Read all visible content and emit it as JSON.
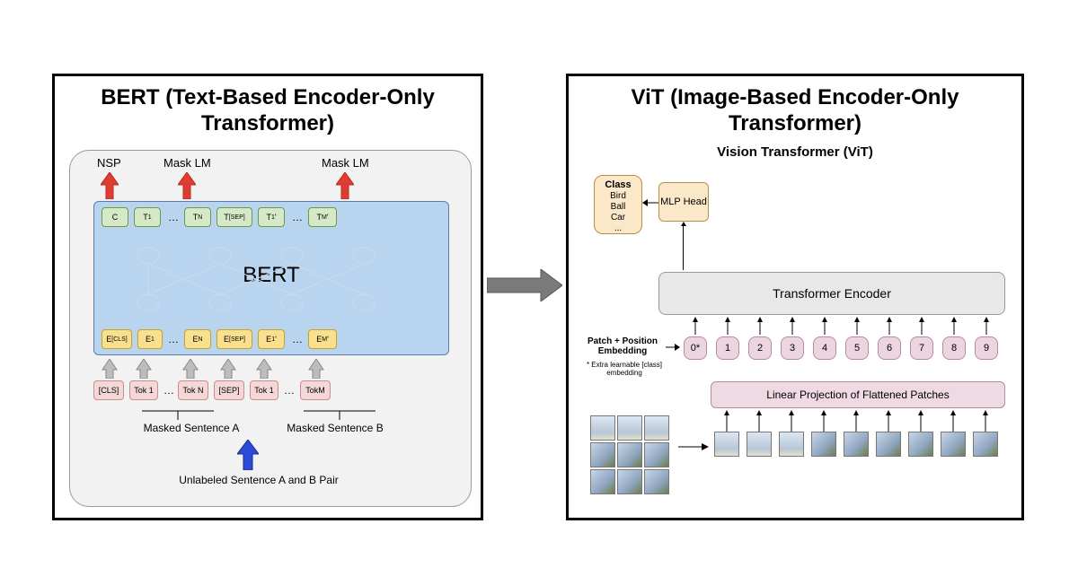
{
  "left": {
    "title": "BERT (Text-Based Encoder-Only Transformer)",
    "top_labels": {
      "nsp": "NSP",
      "mask1": "Mask LM",
      "mask2": "Mask LM"
    },
    "encoder_label": "BERT",
    "output_tokens": [
      "C",
      "T₁",
      "…",
      "T_N",
      "T_[SEP]",
      "T₁'",
      "…",
      "T_M'"
    ],
    "input_embeddings": [
      "E_[CLS]",
      "E₁",
      "…",
      "E_N",
      "E_[SEP]",
      "E₁'",
      "…",
      "E_M'"
    ],
    "input_tokens": [
      "[CLS]",
      "Tok 1",
      "…",
      "Tok N",
      "[SEP]",
      "Tok 1",
      "…",
      "TokM"
    ],
    "caption_a": "Masked Sentence A",
    "caption_b": "Masked Sentence B",
    "caption_pair": "Unlabeled Sentence A and B Pair"
  },
  "right": {
    "title": "ViT (Image-Based Encoder-Only Transformer)",
    "subtitle": "Vision Transformer (ViT)",
    "class_box": {
      "heading": "Class",
      "items": [
        "Bird",
        "Ball",
        "Car",
        "..."
      ]
    },
    "mlp_label": "MLP Head",
    "encoder_label": "Transformer Encoder",
    "patchpos_label": "Patch + Position Embedding",
    "patchpos_note": "* Extra learnable [class] embedding",
    "patch_numbers": [
      "0*",
      "1",
      "2",
      "3",
      "4",
      "5",
      "6",
      "7",
      "8",
      "9"
    ],
    "linproj_label": "Linear Projection of Flattened Patches"
  }
}
